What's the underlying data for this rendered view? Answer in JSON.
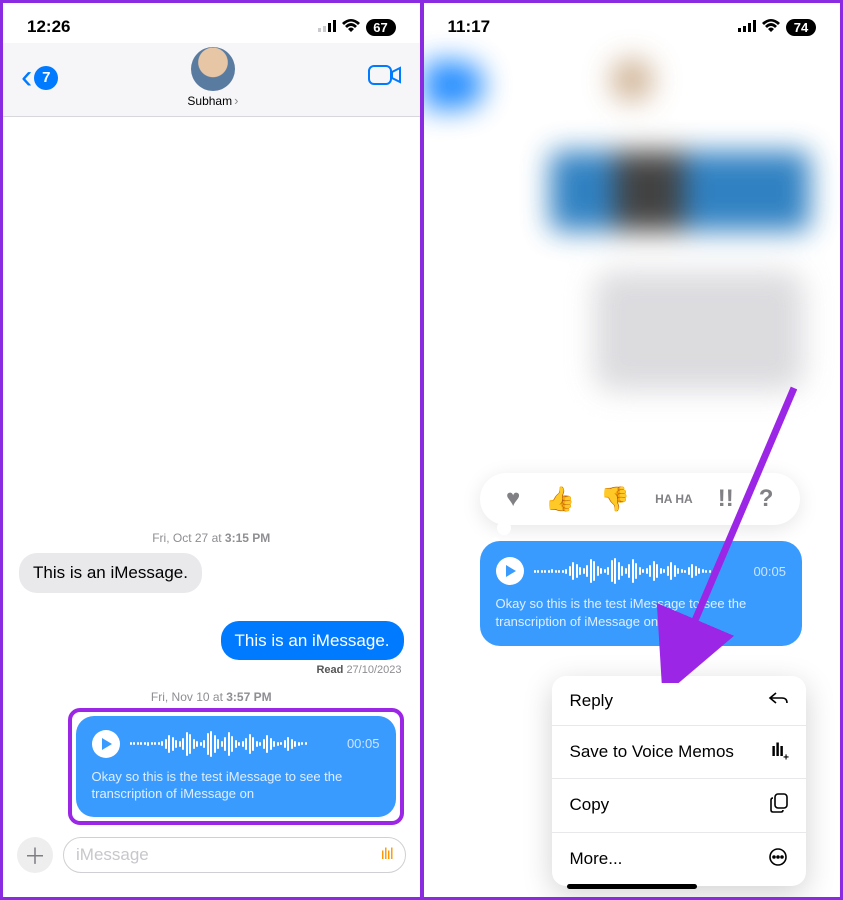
{
  "left": {
    "time": "12:26",
    "battery": "67",
    "unread_badge": "7",
    "contact_name": "Subham",
    "ts1_prefix": "Fri, Oct 27 at ",
    "ts1_time": "3:15 PM",
    "msg_in": "This is an iMessage.",
    "msg_out": "This is an iMessage.",
    "read_label": "Read",
    "read_date": "27/10/2023",
    "ts2_prefix": "Fri, Nov 10 at ",
    "ts2_time": "3:57 PM",
    "audio_duration": "00:05",
    "transcript": "Okay so this is the test iMessage to see the transcription of iMessage on",
    "compose_placeholder": "iMessage"
  },
  "right": {
    "time": "11:17",
    "battery": "74",
    "tapback": {
      "heart": "♥",
      "up": "👍",
      "down": "👎",
      "haha": "HA HA",
      "bang": "!!",
      "q": "?"
    },
    "audio_duration": "00:05",
    "transcript": "Okay so this is the test iMessage to see the transcription of iMessage on",
    "menu": {
      "reply": "Reply",
      "save": "Save to Voice Memos",
      "copy": "Copy",
      "more": "More..."
    }
  }
}
